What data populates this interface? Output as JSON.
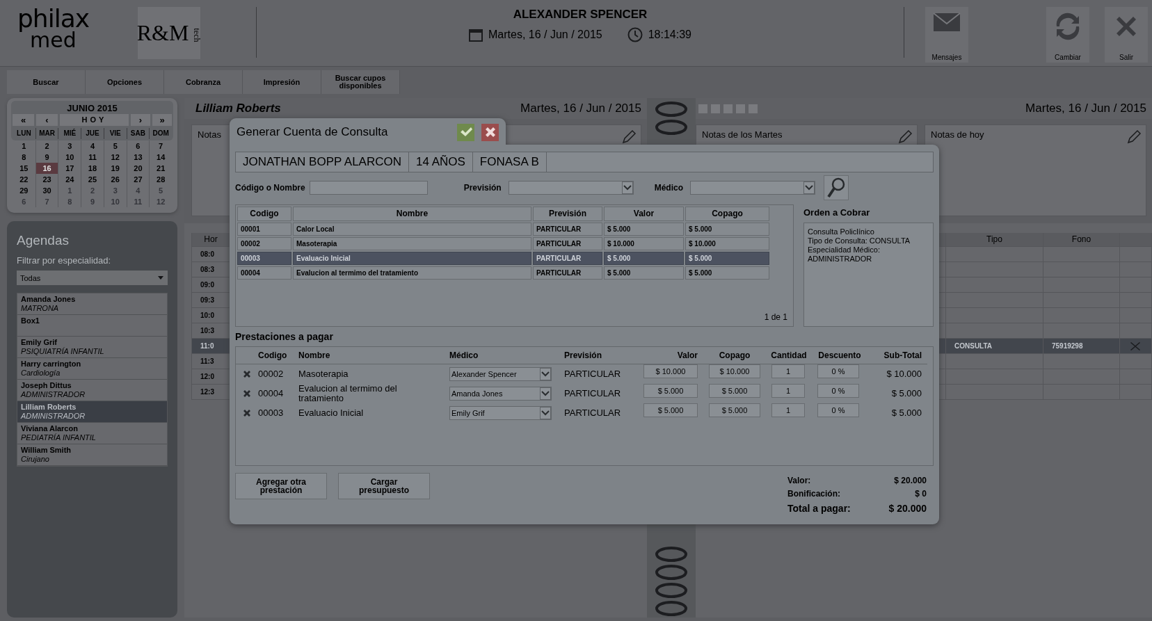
{
  "header": {
    "logo": {
      "name": "philax",
      "sub": "med"
    },
    "partner_logo": {
      "name": "R&M",
      "sub": "tech"
    },
    "user": "ALEXANDER SPENCER",
    "date": "Martes, 16 / Jun / 2015",
    "time": "18:14:39",
    "actions": [
      {
        "label": "Mensajes",
        "kind": "mail"
      },
      {
        "label": "Cambiar",
        "kind": "refresh"
      },
      {
        "label": "Salir",
        "kind": "close"
      }
    ]
  },
  "menu": [
    "Buscar",
    "Opciones",
    "Cobranza",
    "Impresión",
    "Buscar cupos disponibles"
  ],
  "calendar": {
    "title": "JUNIO 2015",
    "nav": [
      "«",
      "‹",
      "HOY",
      "›",
      "»"
    ],
    "weekdays": [
      "LUN",
      "MAR",
      "MIÉ",
      "JUE",
      "VIE",
      "SAB",
      "DOM"
    ],
    "weeks": [
      [
        {
          "day": "1",
          "selected": false,
          "other_month": false
        },
        {
          "day": "2",
          "selected": false,
          "other_month": false
        },
        {
          "day": "3",
          "selected": false,
          "other_month": false
        },
        {
          "day": "4",
          "selected": false,
          "other_month": false
        },
        {
          "day": "5",
          "selected": false,
          "other_month": false
        },
        {
          "day": "6",
          "selected": false,
          "other_month": false
        },
        {
          "day": "7",
          "selected": false,
          "other_month": false
        }
      ],
      [
        {
          "day": "8",
          "selected": false,
          "other_month": false
        },
        {
          "day": "9",
          "selected": false,
          "other_month": false
        },
        {
          "day": "10",
          "selected": false,
          "other_month": false
        },
        {
          "day": "11",
          "selected": false,
          "other_month": false
        },
        {
          "day": "12",
          "selected": false,
          "other_month": false
        },
        {
          "day": "13",
          "selected": false,
          "other_month": false
        },
        {
          "day": "14",
          "selected": false,
          "other_month": false
        }
      ],
      [
        {
          "day": "15",
          "selected": false,
          "other_month": false
        },
        {
          "day": "16",
          "selected": true,
          "other_month": false
        },
        {
          "day": "17",
          "selected": false,
          "other_month": false
        },
        {
          "day": "18",
          "selected": false,
          "other_month": false
        },
        {
          "day": "19",
          "selected": false,
          "other_month": false
        },
        {
          "day": "20",
          "selected": false,
          "other_month": false
        },
        {
          "day": "21",
          "selected": false,
          "other_month": false
        }
      ],
      [
        {
          "day": "22",
          "selected": false,
          "other_month": false
        },
        {
          "day": "23",
          "selected": false,
          "other_month": false
        },
        {
          "day": "24",
          "selected": false,
          "other_month": false
        },
        {
          "day": "25",
          "selected": false,
          "other_month": false
        },
        {
          "day": "26",
          "selected": false,
          "other_month": false
        },
        {
          "day": "27",
          "selected": false,
          "other_month": false
        },
        {
          "day": "28",
          "selected": false,
          "other_month": false
        }
      ],
      [
        {
          "day": "29",
          "selected": false,
          "other_month": false
        },
        {
          "day": "30",
          "selected": false,
          "other_month": false
        },
        {
          "day": "1",
          "selected": false,
          "other_month": true
        },
        {
          "day": "2",
          "selected": false,
          "other_month": true
        },
        {
          "day": "3",
          "selected": false,
          "other_month": true
        },
        {
          "day": "4",
          "selected": false,
          "other_month": true
        },
        {
          "day": "5",
          "selected": false,
          "other_month": true
        }
      ],
      [
        {
          "day": "6",
          "selected": false,
          "other_month": true
        },
        {
          "day": "7",
          "selected": false,
          "other_month": true
        },
        {
          "day": "8",
          "selected": false,
          "other_month": true
        },
        {
          "day": "9",
          "selected": false,
          "other_month": true
        },
        {
          "day": "10",
          "selected": false,
          "other_month": true
        },
        {
          "day": "11",
          "selected": false,
          "other_month": true
        },
        {
          "day": "12",
          "selected": false,
          "other_month": true
        }
      ]
    ]
  },
  "agendas": {
    "title": "Agendas",
    "filter_label": "Filtrar por especialidad:",
    "filter_value": "Todas",
    "doctors": [
      {
        "name": "Amanda Jones",
        "specialty": "MATRONA",
        "selected": false
      },
      {
        "name": "Box1",
        "selected": false
      },
      {
        "name": "Emily Grif",
        "specialty": "PSIQUIATRÍA INFANTIL",
        "selected": false
      },
      {
        "name": "Harry carrington",
        "specialty": "Cardiología",
        "selected": false
      },
      {
        "name": "Joseph Dittus",
        "specialty": "ADMINISTRADOR",
        "selected": false
      },
      {
        "name": "Lilliam Roberts",
        "specialty": "ADMINISTRADOR",
        "selected": true
      },
      {
        "name": "Viviana Alarcon",
        "specialty": "PEDIATRÍA INFANTIL",
        "selected": false
      },
      {
        "name": "William Smith",
        "specialty": "Cirujano",
        "selected": false
      }
    ]
  },
  "schedule": {
    "owner": "Lilliam Roberts",
    "left_date": "Martes, 16 / Jun / 2015",
    "left_notes": "Notas",
    "right_date": "Martes, 16 / Jun / 2015",
    "right_notes": [
      "Notas de los Martes",
      "Notas de hoy"
    ],
    "left_columns": [
      "Hor"
    ],
    "right_columns": [
      "Tipo",
      "Fono"
    ],
    "rows": [
      {
        "time": "08:0",
        "selected": false
      },
      {
        "time": "08:3",
        "selected": false
      },
      {
        "time": "09:0",
        "selected": false
      },
      {
        "time": "09:3",
        "selected": false
      },
      {
        "time": "10:0",
        "selected": false
      },
      {
        "time": "10:3",
        "selected": false
      },
      {
        "time": "11:0",
        "selected": true,
        "tipo": "CONSULTA",
        "fono": "75919298"
      },
      {
        "time": "11:3",
        "selected": false
      },
      {
        "time": "12:0",
        "selected": false
      },
      {
        "time": "12:3",
        "selected": false
      }
    ]
  },
  "dialog": {
    "title": "Generar Cuenta de Consulta",
    "patient": [
      "JONATHAN BOPP ALARCON",
      "14 AÑOS",
      "FONASA B"
    ],
    "filters": [
      {
        "label": "Código o Nombre",
        "kind": "text"
      },
      {
        "label": "Previsión",
        "kind": "select"
      },
      {
        "label": "Médico",
        "kind": "select"
      }
    ],
    "catalog": {
      "columns": [
        "Codigo",
        "Nombre",
        "Previsión",
        "Valor",
        "Copago"
      ],
      "rows": [
        {
          "cells": [
            "00001",
            "Calor Local",
            "PARTICULAR",
            "$ 5.000",
            "$ 5.000"
          ],
          "selected": false
        },
        {
          "cells": [
            "00002",
            "Masoterapia",
            "PARTICULAR",
            "$ 10.000",
            "$ 10.000"
          ],
          "selected": false
        },
        {
          "cells": [
            "00003",
            "Evaluacio Inicial",
            "PARTICULAR",
            "$ 5.000",
            "$ 5.000"
          ],
          "selected": true
        },
        {
          "cells": [
            "00004",
            "Evalucion al termimo del tratamiento",
            "PARTICULAR",
            "$ 5.000",
            "$ 5.000"
          ],
          "selected": false
        }
      ],
      "pager": "1 de 1"
    },
    "order": {
      "title": "Orden a Cobrar",
      "lines": [
        "Consulta Policlínico",
        "Tipo de Consulta: CONSULTA",
        "Especialidad Médico: ADMINISTRADOR"
      ]
    },
    "services": {
      "title": "Prestaciones a pagar",
      "columns": [
        "Codigo",
        "Nombre",
        "Médico",
        "Previsión",
        "Valor",
        "Copago",
        "Cantidad",
        "Descuento",
        "Sub-Total"
      ],
      "rows": [
        {
          "code": "00002",
          "name": "Masoterapia",
          "doctor": "Alexander Spencer",
          "prevision": "PARTICULAR",
          "valor": "$ 10.000",
          "copago": "$ 10.000",
          "cantidad": "1",
          "descuento": "0 %",
          "subtotal": "$ 10.000"
        },
        {
          "code": "00004",
          "name": "Evalucion al termimo del tratamiento",
          "doctor": "Amanda Jones",
          "prevision": "PARTICULAR",
          "valor": "$ 5.000",
          "copago": "$ 5.000",
          "cantidad": "1",
          "descuento": "0 %",
          "subtotal": "$ 5.000"
        },
        {
          "code": "00003",
          "name": "Evaluacio Inicial",
          "doctor": "Emily Grif",
          "prevision": "PARTICULAR",
          "valor": "$ 5.000",
          "copago": "$ 5.000",
          "cantidad": "1",
          "descuento": "0 %",
          "subtotal": "$ 5.000"
        }
      ]
    },
    "buttons": [
      "Agregar otra prestación",
      "Cargar presupuesto"
    ],
    "totals": [
      {
        "label": "Valor:",
        "value": "$ 20.000",
        "kind": "line"
      },
      {
        "label": "Bonificación:",
        "value": "$ 0",
        "kind": "line"
      },
      {
        "label": "Total a pagar:",
        "value": "$ 20.000",
        "kind": "total"
      }
    ]
  }
}
